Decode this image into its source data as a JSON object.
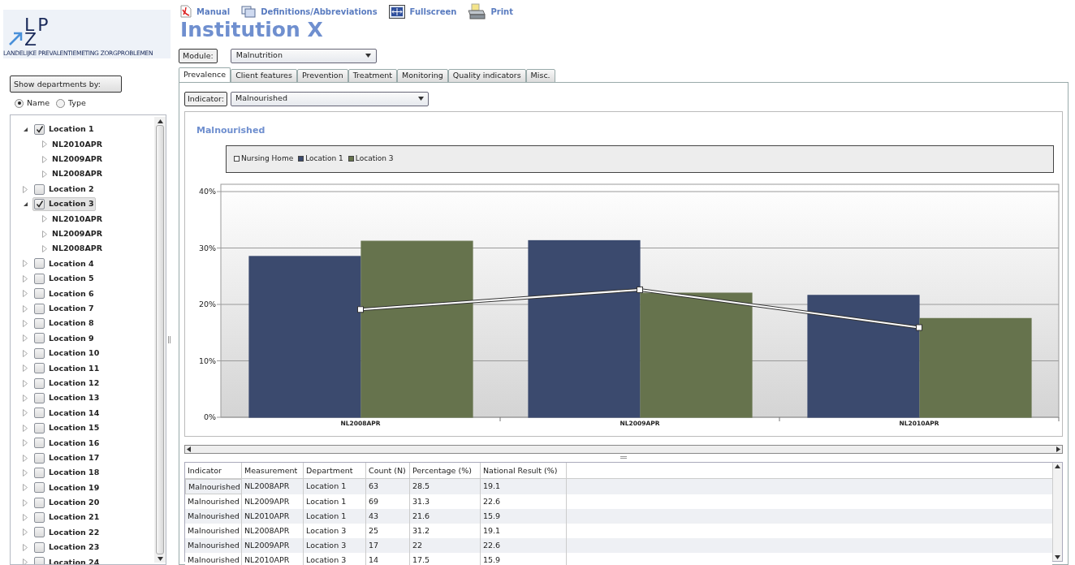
{
  "logo": {
    "top": "LP",
    "bottom": "Z",
    "subtitle": "LANDELIJKE PREVALENTIEMETING ZORGPROBLEMEN"
  },
  "show_by": {
    "button": "Show departments by:",
    "options": [
      {
        "label": "Name",
        "selected": true
      },
      {
        "label": "Type",
        "selected": false
      }
    ]
  },
  "tree": [
    {
      "label": "Location 1",
      "checked": true,
      "expanded": true,
      "selected": false,
      "children": [
        {
          "label": "NL2010APR",
          "expanded": false
        },
        {
          "label": "NL2009APR",
          "expanded": false
        },
        {
          "label": "NL2008APR",
          "expanded": false
        }
      ]
    },
    {
      "label": "Location 2",
      "checked": false,
      "expanded": false,
      "selected": false
    },
    {
      "label": "Location 3",
      "checked": true,
      "expanded": true,
      "selected": true,
      "children": [
        {
          "label": "NL2010APR",
          "expanded": false
        },
        {
          "label": "NL2009APR",
          "expanded": false
        },
        {
          "label": "NL2008APR",
          "expanded": false
        }
      ]
    },
    {
      "label": "Location 4",
      "checked": false,
      "expanded": false,
      "selected": false
    },
    {
      "label": "Location 5",
      "checked": false,
      "expanded": false,
      "selected": false
    },
    {
      "label": "Location 6",
      "checked": false,
      "expanded": false,
      "selected": false
    },
    {
      "label": "Location 7",
      "checked": false,
      "expanded": false,
      "selected": false
    },
    {
      "label": "Location 8",
      "checked": false,
      "expanded": false,
      "selected": false
    },
    {
      "label": "Location 9",
      "checked": false,
      "expanded": false,
      "selected": false
    },
    {
      "label": "Location 10",
      "checked": false,
      "expanded": false,
      "selected": false
    },
    {
      "label": "Location 11",
      "checked": false,
      "expanded": false,
      "selected": false
    },
    {
      "label": "Location 12",
      "checked": false,
      "expanded": false,
      "selected": false
    },
    {
      "label": "Location 13",
      "checked": false,
      "expanded": false,
      "selected": false
    },
    {
      "label": "Location 14",
      "checked": false,
      "expanded": false,
      "selected": false
    },
    {
      "label": "Location 15",
      "checked": false,
      "expanded": false,
      "selected": false
    },
    {
      "label": "Location 16",
      "checked": false,
      "expanded": false,
      "selected": false
    },
    {
      "label": "Location 17",
      "checked": false,
      "expanded": false,
      "selected": false
    },
    {
      "label": "Location 18",
      "checked": false,
      "expanded": false,
      "selected": false
    },
    {
      "label": "Location 19",
      "checked": false,
      "expanded": false,
      "selected": false
    },
    {
      "label": "Location 20",
      "checked": false,
      "expanded": false,
      "selected": false
    },
    {
      "label": "Location 21",
      "checked": false,
      "expanded": false,
      "selected": false
    },
    {
      "label": "Location 22",
      "checked": false,
      "expanded": false,
      "selected": false
    },
    {
      "label": "Location 23",
      "checked": false,
      "expanded": false,
      "selected": false
    },
    {
      "label": "Location 24",
      "checked": false,
      "expanded": false,
      "selected": false
    }
  ],
  "toolbar": [
    {
      "kind": "pdf",
      "label": "Manual"
    },
    {
      "kind": "windows",
      "label": "Definitions/Abbreviations"
    },
    {
      "kind": "fullscreen",
      "label": "Fullscreen"
    },
    {
      "kind": "print",
      "label": "Print"
    }
  ],
  "title": "Institution X",
  "module": {
    "label": "Module:",
    "value": "Malnutrition"
  },
  "tabs": [
    {
      "label": "Prevalence",
      "selected": true
    },
    {
      "label": "Client features",
      "selected": false
    },
    {
      "label": "Prevention",
      "selected": false
    },
    {
      "label": "Treatment",
      "selected": false
    },
    {
      "label": "Monitoring",
      "selected": false
    },
    {
      "label": "Quality indicators",
      "selected": false
    },
    {
      "label": "Misc.",
      "selected": false
    }
  ],
  "indicator": {
    "label": "Indicator:",
    "value": "Malnourished"
  },
  "chart_data": {
    "type": "bar",
    "title": "Malnourished",
    "categories": [
      "NL2008APR",
      "NL2009APR",
      "NL2010APR"
    ],
    "series": [
      {
        "name": "Nursing Home",
        "type": "line",
        "color": "#ffffff",
        "marker": "square",
        "values": [
          19.1,
          22.6,
          15.9
        ]
      },
      {
        "name": "Location 1",
        "type": "bar",
        "color": "#3b4a6e",
        "values": [
          28.5,
          31.3,
          21.6
        ]
      },
      {
        "name": "Location 3",
        "type": "bar",
        "color": "#66734d",
        "values": [
          31.2,
          22,
          17.5
        ]
      }
    ],
    "grid": true,
    "ylim": [
      0,
      40
    ],
    "yticks": [
      {
        "value": 0,
        "label": "0%"
      },
      {
        "value": 10,
        "label": "10%"
      },
      {
        "value": 20,
        "label": "20%"
      },
      {
        "value": 30,
        "label": "30%"
      },
      {
        "value": 40,
        "label": "40%"
      }
    ]
  },
  "table": {
    "columns": [
      "Indicator",
      "Measurement",
      "Department",
      "Count (N)",
      "Percentage (%)",
      "National Result (%)"
    ],
    "rows": [
      [
        "Malnourished",
        "NL2008APR",
        "Location 1",
        "63",
        "28.5",
        "19.1"
      ],
      [
        "Malnourished",
        "NL2009APR",
        "Location 1",
        "69",
        "31.3",
        "22.6"
      ],
      [
        "Malnourished",
        "NL2010APR",
        "Location 1",
        "43",
        "21.6",
        "15.9"
      ],
      [
        "Malnourished",
        "NL2008APR",
        "Location 3",
        "25",
        "31.2",
        "19.1"
      ],
      [
        "Malnourished",
        "NL2009APR",
        "Location 3",
        "17",
        "22",
        "22.6"
      ],
      [
        "Malnourished",
        "NL2010APR",
        "Location 3",
        "14",
        "17.5",
        "15.9"
      ]
    ]
  }
}
